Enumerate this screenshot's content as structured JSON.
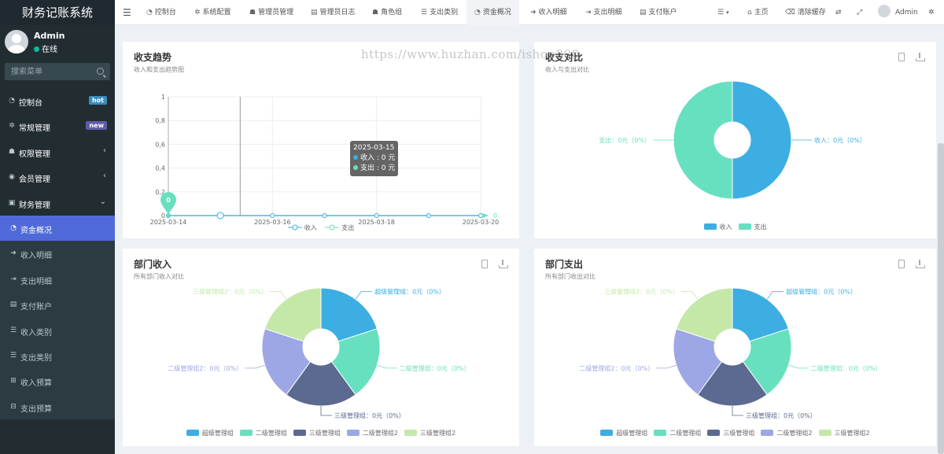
{
  "app": {
    "title": "财务记账系统"
  },
  "user": {
    "name": "Admin",
    "status": "在线"
  },
  "search": {
    "placeholder": "搜索菜单"
  },
  "menu": [
    {
      "label": "控制台",
      "icon": "dashboard-icon",
      "badge": "hot"
    },
    {
      "label": "常规管理",
      "icon": "cogs-icon",
      "badge": "new"
    },
    {
      "label": "权限管理",
      "icon": "users-icon",
      "caret": "‹"
    },
    {
      "label": "会员管理",
      "icon": "user-circle-icon",
      "caret": "‹"
    },
    {
      "label": "财务管理",
      "icon": "money-icon",
      "caret": "⌄"
    },
    {
      "label": "资金概况",
      "icon": "dashboard-icon"
    },
    {
      "label": "收入明细",
      "icon": "sign-in-icon"
    },
    {
      "label": "支出明细",
      "icon": "sign-out-icon"
    },
    {
      "label": "支付账户",
      "icon": "account-icon"
    },
    {
      "label": "收入类别",
      "icon": "list-icon"
    },
    {
      "label": "支出类别",
      "icon": "list-icon"
    },
    {
      "label": "收入预算",
      "icon": "budget-icon"
    },
    {
      "label": "支出预算",
      "icon": "budget-icon"
    }
  ],
  "topnav": {
    "tabs": [
      {
        "label": "控制台"
      },
      {
        "label": "系统配置"
      },
      {
        "label": "管理员管理"
      },
      {
        "label": "管理员日志"
      },
      {
        "label": "角色组"
      },
      {
        "label": "支出类别"
      },
      {
        "label": "资金概况"
      },
      {
        "label": "收入明细"
      },
      {
        "label": "支出明细"
      },
      {
        "label": "支付账户"
      }
    ],
    "home": "主页",
    "clear_cache": "清除缓存",
    "user": "Admin"
  },
  "watermark": "https://www.huzhan.com/ishop800",
  "panels": {
    "trend": {
      "title": "收支趋势",
      "subtitle": "收入和支出趋势图"
    },
    "compare": {
      "title": "收支对比",
      "subtitle": "收入与支出对比"
    },
    "dept_income": {
      "title": "部门收入",
      "subtitle": "所有部门收入对比"
    },
    "dept_expense": {
      "title": "部门支出",
      "subtitle": "所有部门收出对比"
    }
  },
  "tooltip": {
    "date": "2025-03-15",
    "income": "收入 : 0 元",
    "expense": "支出 : 0 元"
  },
  "colors": {
    "income": "#3daee3",
    "expense": "#67e0c0",
    "accent": "#4f6ad8",
    "sidebar": "#222d32"
  },
  "chart_data": [
    {
      "type": "line",
      "x": [
        "2025-03-14",
        "2025-03-15",
        "2025-03-16",
        "2025-03-17",
        "2025-03-18",
        "2025-03-19",
        "2025-03-20"
      ],
      "x_tick_labels": [
        "2025-03-14",
        "2025-03-16",
        "2025-03-18",
        "2025-03-20"
      ],
      "series": [
        {
          "name": "收入",
          "values": [
            0,
            0,
            0,
            0,
            0,
            0,
            0
          ],
          "color": "#3daee3"
        },
        {
          "name": "支出",
          "values": [
            0,
            0,
            0,
            0,
            0,
            0,
            0
          ],
          "color": "#67e0c0"
        }
      ],
      "ylim": [
        0,
        1
      ],
      "y_ticks": [
        "0",
        "0,2",
        "0,4",
        "0,6",
        "0,8",
        "1"
      ],
      "marker": {
        "label": "0",
        "x": "2025-03-14"
      },
      "end_label": "0",
      "grid": true,
      "legend": "bottom"
    },
    {
      "type": "pie",
      "labels": [
        "收入",
        "支出"
      ],
      "values": [
        0,
        0
      ],
      "slice_labels": [
        "收入：0元（0%）",
        "支出：0元（0%）"
      ],
      "colors": [
        "#3daee3",
        "#67e0c0"
      ],
      "legend": "bottom"
    },
    {
      "type": "pie",
      "labels": [
        "超级管理组",
        "二级管理组",
        "三级管理组",
        "二级管理组2",
        "三级管理组2"
      ],
      "values": [
        0,
        0,
        0,
        0,
        0
      ],
      "slice_labels": [
        "超级管理组：0元（0%）",
        "二级管理组：0元（0%）",
        "三级管理组：0元（0%）",
        "二级管理组2：0元（0%）",
        "三级管理组2：0元（0%）"
      ],
      "colors": [
        "#3daee3",
        "#67e0c0",
        "#5c6990",
        "#9ea7e5",
        "#c4e8a8"
      ],
      "legend": "bottom"
    },
    {
      "type": "pie",
      "labels": [
        "超级管理组",
        "二级管理组",
        "三级管理组",
        "二级管理组2",
        "三级管理组2"
      ],
      "values": [
        0,
        0,
        0,
        0,
        0
      ],
      "slice_labels": [
        "超级管理组：0元（0%）",
        "二级管理组：0元（0%）",
        "三级管理组：0元（0%）",
        "二级管理组2：0元（0%）",
        "三级管理组2：0元（0%）"
      ],
      "colors": [
        "#3daee3",
        "#67e0c0",
        "#5c6990",
        "#9ea7e5",
        "#c4e8a8"
      ],
      "legend": "bottom"
    }
  ]
}
